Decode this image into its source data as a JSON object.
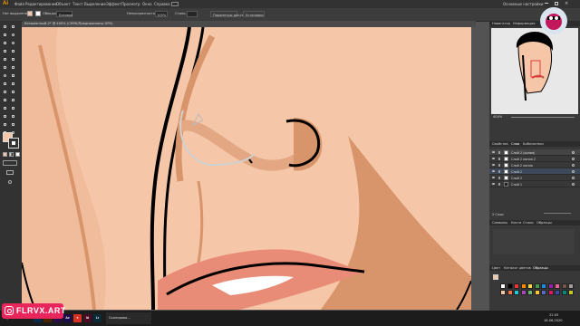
{
  "app": {
    "logo": "Ai",
    "menus": [
      "Файл",
      "Редактирование",
      "Объект",
      "Текст",
      "Выделение",
      "Эффект",
      "Просмотр",
      "Окно",
      "Справка"
    ],
    "workspace": "Основные настройки"
  },
  "control_bar": {
    "selection_label": "Нет выделения",
    "stroke_label": "Обводка:",
    "brush_value": "Базовая",
    "opacity_label": "Непрозрачность:",
    "opacity_value": "100%",
    "style_label": "Стиль:",
    "doc_settings": "Параметры документа",
    "prefs": "Установки",
    "fill_color": "#f5c6a8",
    "stroke_color": "#ffffff"
  },
  "document": {
    "tab_title": "Безымянный-2* @ 400% (CMYK/Предпросмотр GPU)",
    "close_glyph": "×"
  },
  "right_panel": {
    "top_tabs": [
      "Навигатор",
      "Информация"
    ],
    "zoom_value": "400%",
    "mid_tabs": [
      "Свойства",
      "Слои",
      "Библиотеки"
    ],
    "layers": [
      {
        "name": "Слой 2 (копия)"
      },
      {
        "name": "Слой 2 копия 2"
      },
      {
        "name": "Слой 2 копия"
      },
      {
        "name": "Слой 2"
      },
      {
        "name": "Слой 2"
      },
      {
        "name": "Слой 1"
      }
    ],
    "layers_count": "2 Слои",
    "symbols_tabs": [
      "Символы",
      "Кисти",
      "Стили",
      "Образцы"
    ],
    "color_tabs": [
      "Цвет",
      "Каталог цветов",
      "Образцы"
    ],
    "swatch_colors": [
      "#ffffff",
      "#000000",
      "#e53935",
      "#fb8c00",
      "#fdd835",
      "#43a047",
      "#1e88e5",
      "#8e24aa",
      "#f06292",
      "#795548",
      "#9e9e9e",
      "#f5c6a8",
      "#ff7043",
      "#26c6da",
      "#ab47bc",
      "#66bb6a",
      "#ffca28",
      "#5c6bc0",
      "#d81b60",
      "#3949ab",
      "#00897b",
      "#c0ca33"
    ]
  },
  "taskbar": {
    "icons": [
      {
        "label": "⊞",
        "color": "#1c1c1c"
      },
      {
        "label": "⌕",
        "color": "#1c1c1c"
      },
      {
        "label": "▭",
        "color": "#1c1c1c"
      },
      {
        "label": "Ps",
        "color": "#0b2b4a"
      },
      {
        "label": "Ai",
        "color": "#4a2400"
      },
      {
        "label": "Pr",
        "color": "#2a0b4a"
      },
      {
        "label": "Ae",
        "color": "#1d0b4a"
      },
      {
        "label": "●",
        "color": "#d93025"
      },
      {
        "label": "Id",
        "color": "#4a0b25"
      },
      {
        "label": "Lr",
        "color": "#0b2a3a"
      }
    ],
    "task_label": "Сканирова...",
    "time": "22:05",
    "date": "16.06.2020"
  },
  "watermark": {
    "text": "FLRVX.ART"
  }
}
